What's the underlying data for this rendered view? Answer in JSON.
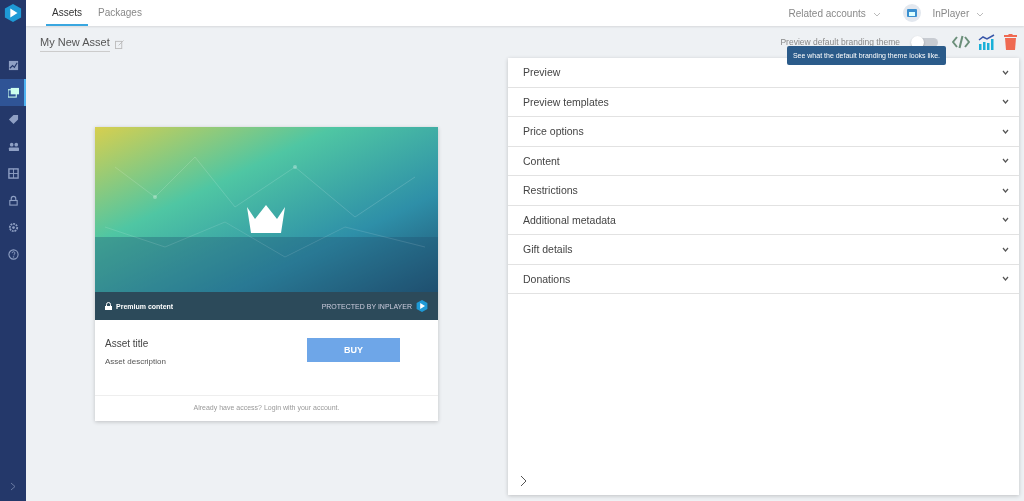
{
  "sidebar": {
    "items": [
      {
        "kind": "chart",
        "selected": false
      },
      {
        "kind": "assets",
        "selected": true
      },
      {
        "kind": "tag",
        "selected": false
      },
      {
        "kind": "users",
        "selected": false
      },
      {
        "kind": "grid",
        "selected": false
      },
      {
        "kind": "lock",
        "selected": false
      },
      {
        "kind": "gear",
        "selected": false
      },
      {
        "kind": "help",
        "selected": false
      }
    ]
  },
  "tabs": [
    {
      "label": "Assets",
      "selected": true
    },
    {
      "label": "Packages",
      "selected": false
    }
  ],
  "header": {
    "related_accounts": "Related accounts",
    "account": "InPlayer"
  },
  "asset": {
    "name": "My New Asset"
  },
  "toolbar": {
    "preview_label": "Preview default branding theme",
    "preview_on": false,
    "tooltip": "See what the default branding theme looks like."
  },
  "card": {
    "premium": "Premium content",
    "protected": "PROTECTED BY INPLAYER",
    "title": "Asset title",
    "description": "Asset description",
    "buy": "BUY",
    "login": "Already have access? Login with your account."
  },
  "sections": [
    {
      "label": "Preview"
    },
    {
      "label": "Preview templates"
    },
    {
      "label": "Price options"
    },
    {
      "label": "Content"
    },
    {
      "label": "Restrictions"
    },
    {
      "label": "Additional metadata"
    },
    {
      "label": "Gift details"
    },
    {
      "label": "Donations"
    }
  ]
}
